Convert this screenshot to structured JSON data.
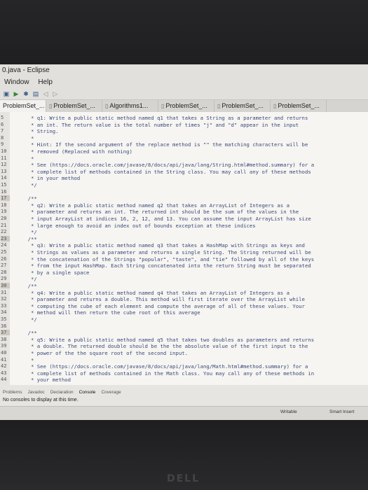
{
  "window": {
    "title": "0.java - Eclipse"
  },
  "menu": [
    "Window",
    "Help"
  ],
  "toolbar_icons": [
    "new-icon",
    "run-icon",
    "debug-icon",
    "save-icon",
    "back-icon",
    "forward-icon"
  ],
  "tabs": [
    {
      "label": "ProblemSet_..."
    },
    {
      "label": "ProblemSet_..."
    },
    {
      "label": "Algorithms1..."
    },
    {
      "label": "ProblemSet_..."
    },
    {
      "label": "ProblemSet_..."
    },
    {
      "label": "ProblemSet_..."
    }
  ],
  "code_lines": [
    {
      "n": "5",
      "t": "     * q1: Write a public static method named q1 that takes a String as a parameter and returns"
    },
    {
      "n": "6",
      "t": "     * an int. The return value is the total number of times \"j\" and \"d\" appear in the input"
    },
    {
      "n": "7",
      "t": "     * String."
    },
    {
      "n": "8",
      "t": "     *"
    },
    {
      "n": "9",
      "t": "     * Hint: If the second argument of the replace method is \"\" the matching characters will be"
    },
    {
      "n": "10",
      "t": "     * removed (Replaced with nothing)"
    },
    {
      "n": "11",
      "t": "     *"
    },
    {
      "n": "12",
      "t": "     * See (https://docs.oracle.com/javase/8/docs/api/java/lang/String.html#method.summary) for a"
    },
    {
      "n": "13",
      "t": "     * complete list of methods contained in the String class. You may call any of these methods"
    },
    {
      "n": "14",
      "t": "     * in your method"
    },
    {
      "n": "15",
      "t": "     */"
    },
    {
      "n": "16",
      "t": ""
    },
    {
      "n": "17",
      "t": "    /**"
    },
    {
      "n": "18",
      "t": "     * q2: Write a public static method named q2 that takes an ArrayList of Integers as a"
    },
    {
      "n": "19",
      "t": "     * parameter and returns an int. The returned int should be the sum of the values in the"
    },
    {
      "n": "20",
      "t": "     * input ArrayList at indices 16, 2, 12, and 13. You can assume the input ArrayList has size"
    },
    {
      "n": "21",
      "t": "     * large enough to avoid an index out of bounds exception at these indices"
    },
    {
      "n": "22",
      "t": "     */"
    },
    {
      "n": "23",
      "t": "    /**"
    },
    {
      "n": "24",
      "t": "     * q3: Write a public static method named q3 that takes a HashMap with Strings as keys and"
    },
    {
      "n": "25",
      "t": "     * Strings as values as a parameter and returns a single String. The String returned will be"
    },
    {
      "n": "26",
      "t": "     * the concatenation of the Strings \"popular\", \"taste\", and \"tie\" followed by all of the keys"
    },
    {
      "n": "27",
      "t": "     * from the input HashMap. Each String concatenated into the return String must be separated"
    },
    {
      "n": "28",
      "t": "     * by a single space"
    },
    {
      "n": "29",
      "t": "     */"
    },
    {
      "n": "30",
      "t": "    /**"
    },
    {
      "n": "31",
      "t": "     * q4: Write a public static method named q4 that takes an ArrayList of Integers as a"
    },
    {
      "n": "32",
      "t": "     * parameter and returns a double. This method will first iterate over the ArrayList while"
    },
    {
      "n": "33",
      "t": "     * computing the cube of each element and compute the average of all of these values. Your"
    },
    {
      "n": "34",
      "t": "     * method will then return the cube root of this average"
    },
    {
      "n": "35",
      "t": "     */"
    },
    {
      "n": "36",
      "t": ""
    },
    {
      "n": "37",
      "t": "    /**"
    },
    {
      "n": "38",
      "t": "     * q5: Write a public static method named q5 that takes two doubles as parameters and returns"
    },
    {
      "n": "39",
      "t": "     * a double. The returned double should be the the absolute value of the first input to the"
    },
    {
      "n": "40",
      "t": "     * power of the the square root of the second input."
    },
    {
      "n": "41",
      "t": "     *"
    },
    {
      "n": "42",
      "t": "     * See (https://docs.oracle.com/javase/8/docs/api/java/lang/Math.html#method.summary) for a"
    },
    {
      "n": "43",
      "t": "     * complete list of methods contained in the Math class. You may call any of these methods in"
    },
    {
      "n": "44",
      "t": "     * your method"
    }
  ],
  "console": {
    "tabs": [
      "Problems",
      "Javadoc",
      "Declaration",
      "Console",
      "Coverage"
    ],
    "message": "No consoles to display at this time."
  },
  "status": {
    "writable": "Writable",
    "insert_mode": "Smart Insert"
  },
  "bezel_logo": "DELL"
}
